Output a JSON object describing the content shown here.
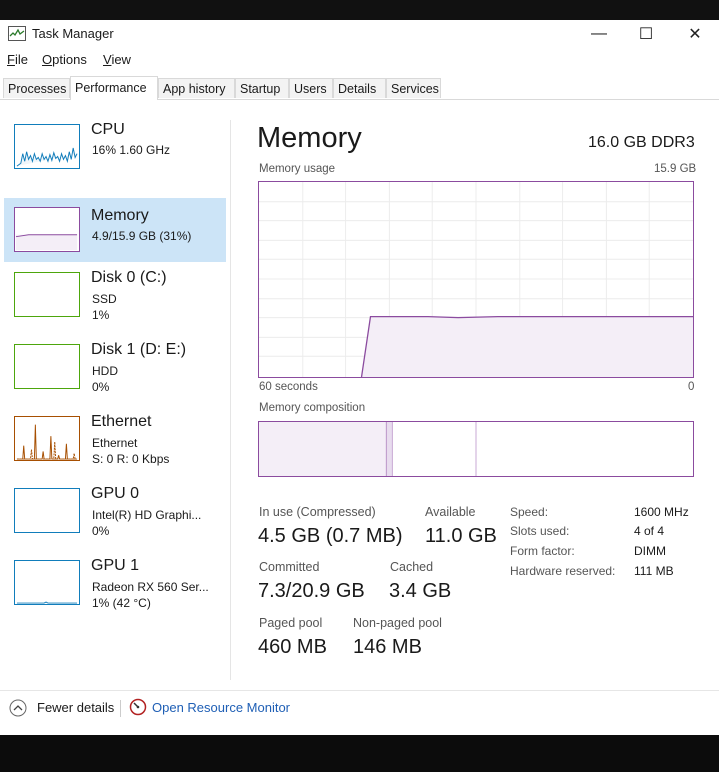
{
  "window": {
    "title": "Task Manager",
    "controls": {
      "minimize": "—",
      "maximize": "☐",
      "close": "✕"
    }
  },
  "menu": {
    "file": "File",
    "options": "Options",
    "view": "View"
  },
  "tabs": [
    "Processes",
    "Performance",
    "App history",
    "Startup",
    "Users",
    "Details",
    "Services"
  ],
  "active_tab": "Performance",
  "devices": [
    {
      "name": "CPU",
      "lines": [
        "16% 1.60 GHz"
      ]
    },
    {
      "name": "Memory",
      "lines": [
        "4.9/15.9 GB (31%)"
      ]
    },
    {
      "name": "Disk 0 (C:)",
      "lines": [
        "SSD",
        "1%"
      ]
    },
    {
      "name": "Disk 1 (D: E:)",
      "lines": [
        "HDD",
        "0%"
      ]
    },
    {
      "name": "Ethernet",
      "lines": [
        "Ethernet",
        "S: 0 R: 0 Kbps"
      ]
    },
    {
      "name": "GPU 0",
      "lines": [
        "Intel(R) HD Graphi...",
        "0%"
      ]
    },
    {
      "name": "GPU 1",
      "lines": [
        "Radeon RX 560 Ser...",
        "1% (42 °C)"
      ]
    }
  ],
  "main": {
    "title": "Memory",
    "spec": "16.0 GB DDR3",
    "usage_label": "Memory usage",
    "usage_max": "15.9 GB",
    "time_left": "60 seconds",
    "time_right": "0",
    "composition_label": "Memory composition"
  },
  "stats": {
    "in_use_label": "In use (Compressed)",
    "in_use_value": "4.5 GB (0.7 MB)",
    "available_label": "Available",
    "available_value": "11.0 GB",
    "committed_label": "Committed",
    "committed_value": "7.3/20.9 GB",
    "cached_label": "Cached",
    "cached_value": "3.4 GB",
    "paged_label": "Paged pool",
    "paged_value": "460 MB",
    "nonpaged_label": "Non-paged pool",
    "nonpaged_value": "146 MB"
  },
  "specs": [
    {
      "label": "Speed:",
      "value": "1600 MHz"
    },
    {
      "label": "Slots used:",
      "value": "4 of 4"
    },
    {
      "label": "Form factor:",
      "value": "DIMM"
    },
    {
      "label": "Hardware reserved:",
      "value": "111 MB"
    }
  ],
  "footer": {
    "fewer_details": "Fewer details",
    "resource_monitor": "Open Resource Monitor"
  },
  "colors": {
    "memory_accent": "#8b4b9f",
    "cpu_accent": "#117dbb",
    "disk_accent": "#4da60c",
    "ethernet_accent": "#a74f01",
    "selected_bg": "#cce4f7"
  }
}
